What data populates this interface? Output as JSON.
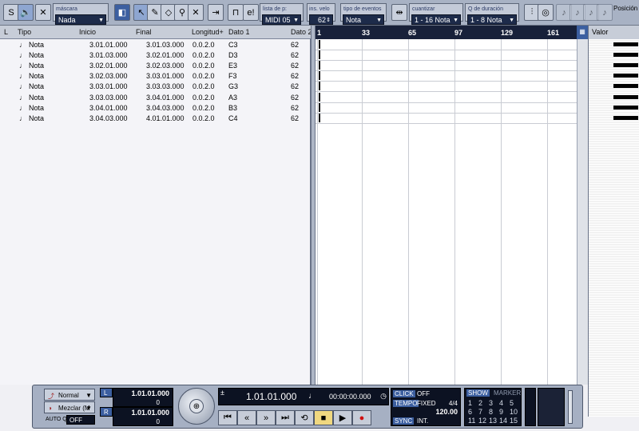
{
  "toolbar": {
    "mascara_label": "máscara",
    "mascara_value": "Nada",
    "lista_label": "lista de p:",
    "lista_value": "MIDI 05",
    "ins_velo_label": "ins. velo",
    "ins_velo_value": "62",
    "tipo_eventos_label": "tipo de eventos",
    "tipo_eventos_value": "Nota",
    "cuantizar_label": "cuantizar",
    "cuantizar_value": "1 - 16 Nota",
    "q_duracion_label": "Q de duración",
    "q_duracion_value": "1 - 8 Nota",
    "posicion_label": "Posición"
  },
  "list": {
    "columns": [
      "L",
      "Tipo",
      "Inicio",
      "Final",
      "Longitud+",
      "Dato 1",
      "Dato 2"
    ],
    "rows": [
      {
        "tipo": "Nota",
        "inicio": "3.01.01.000",
        "final": "3.01.03.000",
        "longitud": "0.0.2.0",
        "dato1": "C3",
        "dato2": "62"
      },
      {
        "tipo": "Nota",
        "inicio": "3.01.03.000",
        "final": "3.02.01.000",
        "longitud": "0.0.2.0",
        "dato1": "D3",
        "dato2": "62"
      },
      {
        "tipo": "Nota",
        "inicio": "3.02.01.000",
        "final": "3.02.03.000",
        "longitud": "0.0.2.0",
        "dato1": "E3",
        "dato2": "62"
      },
      {
        "tipo": "Nota",
        "inicio": "3.02.03.000",
        "final": "3.03.01.000",
        "longitud": "0.0.2.0",
        "dato1": "F3",
        "dato2": "62"
      },
      {
        "tipo": "Nota",
        "inicio": "3.03.01.000",
        "final": "3.03.03.000",
        "longitud": "0.0.2.0",
        "dato1": "G3",
        "dato2": "62"
      },
      {
        "tipo": "Nota",
        "inicio": "3.03.03.000",
        "final": "3.04.01.000",
        "longitud": "0.0.2.0",
        "dato1": "A3",
        "dato2": "62"
      },
      {
        "tipo": "Nota",
        "inicio": "3.04.01.000",
        "final": "3.04.03.000",
        "longitud": "0.0.2.0",
        "dato1": "B3",
        "dato2": "62"
      },
      {
        "tipo": "Nota",
        "inicio": "3.04.03.000",
        "final": "4.01.01.000",
        "longitud": "0.0.2.0",
        "dato1": "C4",
        "dato2": "62"
      }
    ]
  },
  "ruler": {
    "marks": [
      "1",
      "33",
      "65",
      "97",
      "129",
      "161"
    ]
  },
  "value_panel": {
    "header": "Valor"
  },
  "transport": {
    "mode_label": "Normal",
    "mix_label": "Mezclar (M",
    "autoq_label": "AUTO Q",
    "autoq_value": "OFF",
    "left_locator": "1.01.01.000",
    "left_value": "0",
    "right_locator": "1.01.01.000",
    "right_value": "0",
    "position": "1.01.01.000",
    "time": "00:00:00.000",
    "click_label": "CLICK",
    "click_value": "OFF",
    "tempo_label": "TEMPO",
    "tempo_mode": "FIXED",
    "signature": "4/4",
    "tempo_value": "120.00",
    "sync_label": "SYNC",
    "sync_value": "INT.",
    "show_label": "SHOW",
    "marker_label": "MARKER",
    "marker_numbers": [
      "1",
      "2",
      "3",
      "4",
      "5",
      "6",
      "7",
      "8",
      "9",
      "10",
      "11",
      "12",
      "13",
      "14",
      "15"
    ]
  },
  "colors": {
    "toolbar": "#a8b2c4",
    "field": "#1d2b4a",
    "ruler": "#18213a",
    "active": "#3c5fa0"
  }
}
